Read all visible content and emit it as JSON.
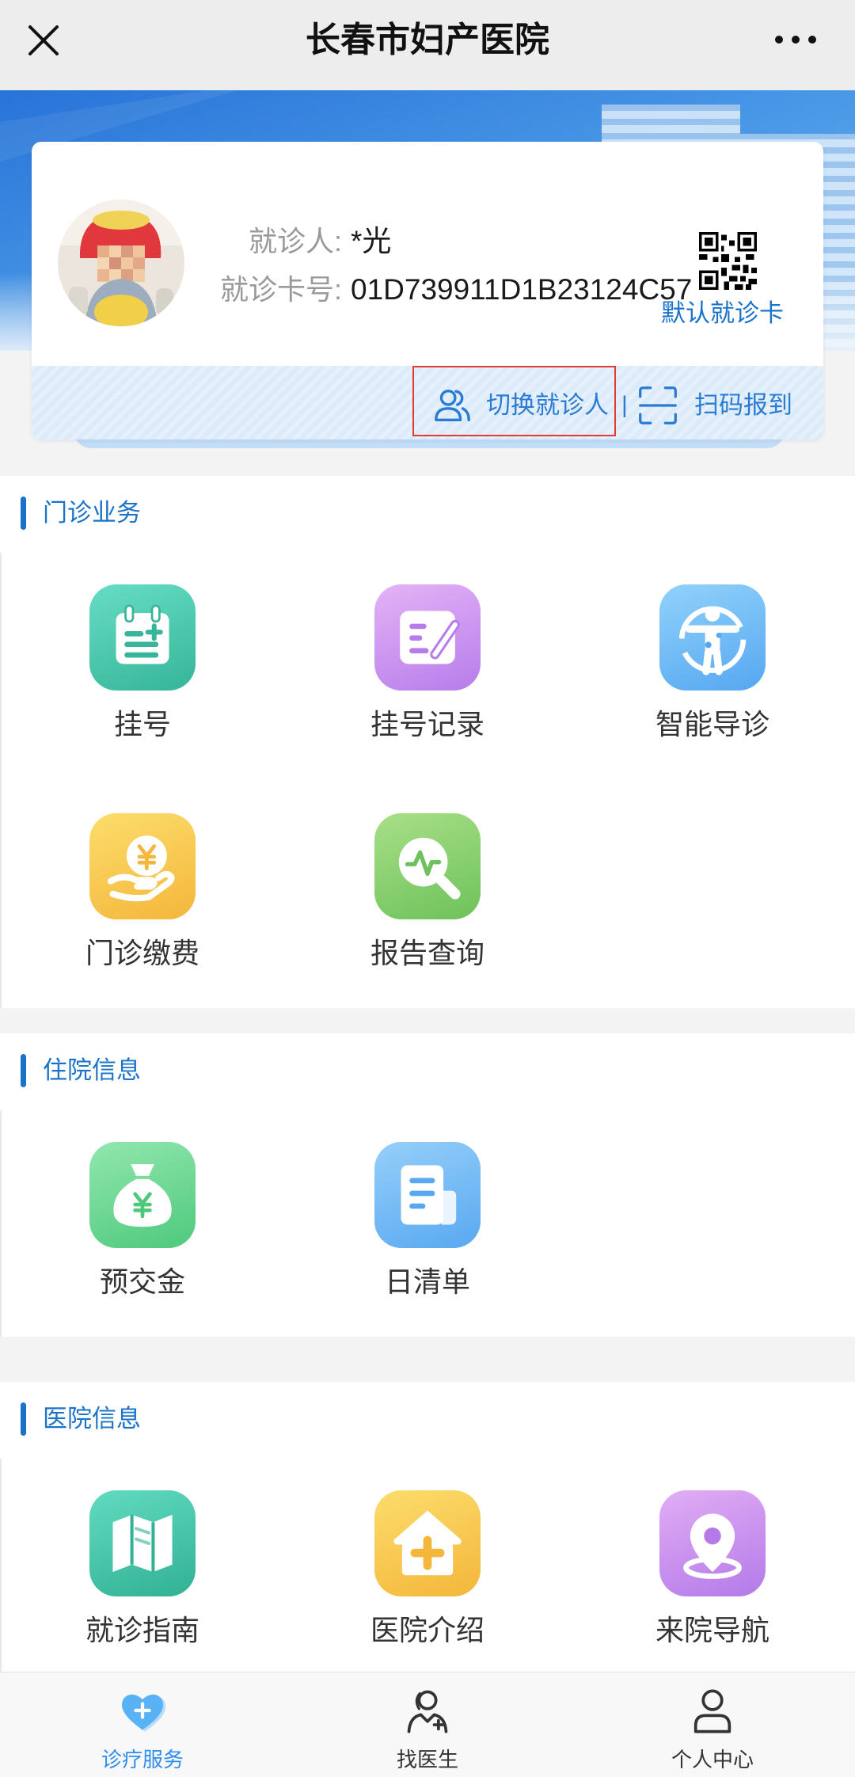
{
  "nav": {
    "title": "长春市妇产医院",
    "close_icon": "close-icon",
    "more_icon": "more-icon"
  },
  "patient": {
    "avatar_icon": "avatar",
    "name_label": "就诊人:",
    "name_value": "*光",
    "card_label": "就诊卡号:",
    "card_value": "01D739911D1B23124C57",
    "qr_icon": "qr-code-icon",
    "default_card_label": "默认就诊卡",
    "switch_icon": "switch-patient-icon",
    "switch_label": "切换就诊人",
    "separator": "|",
    "scan_icon": "scan-icon",
    "scan_label": "扫码报到"
  },
  "sections": [
    {
      "title": "门诊业务",
      "items": [
        {
          "label": "挂号",
          "icon": "register-calendar-icon",
          "colors": [
            "#66ddc4",
            "#36b599"
          ]
        },
        {
          "label": "挂号记录",
          "icon": "record-edit-icon",
          "colors": [
            "#e4b3f6",
            "#b77ceb"
          ]
        },
        {
          "label": "智能导诊",
          "icon": "smart-guide-person-icon",
          "colors": [
            "#92d2fb",
            "#55a7f1"
          ]
        },
        {
          "label": "门诊缴费",
          "icon": "payment-hand-coin-icon",
          "colors": [
            "#fcdd6c",
            "#f4b63b"
          ]
        },
        {
          "label": "报告查询",
          "icon": "report-search-icon",
          "colors": [
            "#a9df87",
            "#6dc25b"
          ]
        }
      ]
    },
    {
      "title": "住院信息",
      "items": [
        {
          "label": "预交金",
          "icon": "money-bag-icon",
          "colors": [
            "#92e7ae",
            "#4ec97c"
          ]
        },
        {
          "label": "日清单",
          "icon": "daily-list-document-icon",
          "colors": [
            "#96cffa",
            "#58a8f1"
          ]
        }
      ]
    },
    {
      "title": "医院信息",
      "items": [
        {
          "label": "就诊指南",
          "icon": "map-guide-icon",
          "colors": [
            "#61dbbf",
            "#32b194"
          ]
        },
        {
          "label": "医院介绍",
          "icon": "hospital-house-icon",
          "colors": [
            "#fcdd6c",
            "#f4b63b"
          ]
        },
        {
          "label": "来院导航",
          "icon": "location-pin-icon",
          "colors": [
            "#e1ad f5",
            "#b47ae8"
          ]
        }
      ]
    }
  ],
  "tabs": [
    {
      "label": "诊疗服务",
      "icon": "heart-plus-icon",
      "active": true
    },
    {
      "label": "找医生",
      "icon": "doctor-icon",
      "active": false
    },
    {
      "label": "个人中心",
      "icon": "person-icon",
      "active": false
    }
  ],
  "colors": {
    "accent": "#1a73c8",
    "link": "#2a7bd3",
    "active_tab": "#2f8ef0",
    "highlight_box": "#e53935"
  }
}
